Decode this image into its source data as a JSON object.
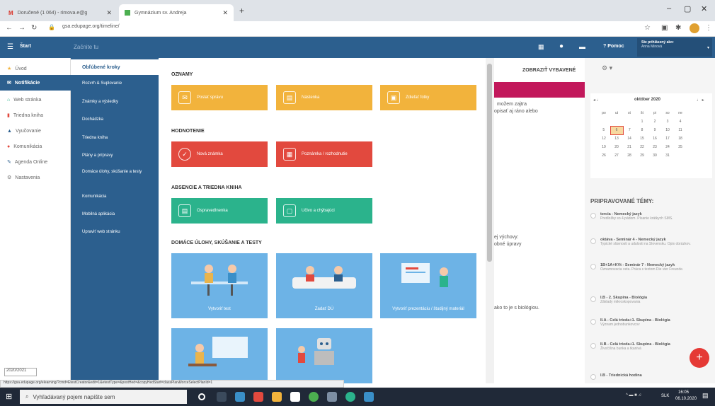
{
  "browser": {
    "tabs": [
      {
        "title": "Doručené (1 064) - rimova.e@g",
        "icon": "gmail-icon"
      },
      {
        "title": "Gymnázium sv. Andreja",
        "icon": "edupage-icon"
      }
    ],
    "new_tab": "+",
    "url": "gsa.edupage.org/timeline/",
    "controls": {
      "minimize": "–",
      "maximize": "▢",
      "close": "✕"
    }
  },
  "topbar": {
    "start_label": "Štart",
    "search_placeholder": "Začnite tu",
    "help_label": "Pomoc",
    "user_line1": "Ste prihlásený ako:",
    "user_line2": "Anna Minová"
  },
  "left_nav": {
    "items": [
      {
        "label": "Úvod",
        "icon": "star-icon"
      },
      {
        "label": "Notifikácie",
        "icon": "mail-icon"
      },
      {
        "label": "Web stránka",
        "icon": "home-icon"
      },
      {
        "label": "Triedna kniha",
        "icon": "book-icon"
      },
      {
        "label": "Vyučovanie",
        "icon": "class-icon"
      },
      {
        "label": "Komunikácia",
        "icon": "chat-icon"
      },
      {
        "label": "Agenda Online",
        "icon": "pen-icon"
      },
      {
        "label": "Nastavenia",
        "icon": "gear-icon"
      }
    ],
    "school_year": "2020/2021"
  },
  "menu": {
    "items": [
      "Obľúbené kroky",
      "Rozvrh & Suplovanie",
      "Známky a výsledky",
      "Dochádzka",
      "Triedna kniha",
      "Plány a prípravy",
      "Domáce úlohy, skúšanie a testy",
      "Komunikácia",
      "Mobilná aplikácia",
      "Upraviť web stránku"
    ]
  },
  "panel": {
    "sections": {
      "oznamy": "OZNAMY",
      "hodnotenie": "HODNOTENIE",
      "absencie": "ABSENCIE A TRIEDNA KNIHA",
      "ulohy": "DOMÁCE ÚLOHY, SKÚŠANIE A TESTY"
    },
    "cards": {
      "poslat_spravu": "Poslať správu",
      "nastenka": "Nástenka",
      "zdielat_fotky": "Zdieľať fotky",
      "nova_znamka": "Nová známka",
      "poznamka": "Poznámka / rozhodnutie",
      "ospravedlnenka": "Ospravedlnenka",
      "ucivo": "Učivo a chýbajúci",
      "vytvorit_test": "Vytvoriť test",
      "zadat_du": "Zadať DÚ",
      "prezentacia": "Vytvoriť prezentáciu / študijný materiál"
    }
  },
  "content": {
    "show_saved": "ZOBRAZIŤ VYBAVENÉ",
    "snip1": "možem zajtra",
    "snip2": "opisať aj ráno alebo",
    "snip3": "ej výchovy:",
    "snip4": "obné úpravy",
    "snip5": "ako to je s biológiou."
  },
  "calendar": {
    "month": "október 2020",
    "prev": "◂ ♩",
    "next": "♩ ▸",
    "days": [
      "po",
      "ut",
      "st",
      "št",
      "pi",
      "so",
      "ne"
    ],
    "rows": [
      [
        "",
        "",
        "",
        "1",
        "2",
        "3",
        "4"
      ],
      [
        "5",
        "6",
        "7",
        "8",
        "9",
        "10",
        "11"
      ],
      [
        "12",
        "13",
        "14",
        "15",
        "16",
        "17",
        "18"
      ],
      [
        "19",
        "20",
        "21",
        "22",
        "23",
        "24",
        "25"
      ],
      [
        "26",
        "27",
        "28",
        "29",
        "30",
        "31",
        ""
      ]
    ],
    "today": "6"
  },
  "topics": {
    "title": "PRIPRAVOVANÉ TÉMY:",
    "items": [
      {
        "t": "tercia - Nemecký jazyk",
        "s": "Predložky so 4.pádom. Písanie krátkych SMS."
      },
      {
        "t": "oktáva - Seminár 4 - Nemecký jazyk",
        "s": "Typické slávnosti a udalosti na Slovensku. Opis obrázkov."
      },
      {
        "t": "1B+1A+KVt - Seminár 7 - Nemecký jazyk",
        "s": "Oznamovacia veta. Práca s textom Die vier Freunde."
      },
      {
        "t": "I.B - 2. Skupina - Biológia",
        "s": "Základy mikroskopovania"
      },
      {
        "t": "II.A - Celá trieda+1. Skupina - Biológia",
        "s": "Význam jednobunkovcov"
      },
      {
        "t": "II.B - Celá trieda+1. Skupina - Biológia",
        "s": "Živočíšna bunka a tkanivá"
      },
      {
        "t": "I.B - Triednická hodina",
        "s": ""
      }
    ]
  },
  "status_url": "https://gsa.edupage.org/elearning/?cmd=EtestCreator&edit=1&etestType=&postHed=&copyHedStart=classPlan&forceSelectPlanId=1",
  "taskbar": {
    "search_placeholder": "Vyhľadávaný pojem napíšte sem",
    "lang": "SLK",
    "time": "16:05",
    "date": "06.10.2020"
  },
  "colors": {
    "brand": "#2c5f8e",
    "yellow": "#f2b33c",
    "red": "#e2493e",
    "green": "#2bb38c",
    "fab": "#e53935"
  }
}
